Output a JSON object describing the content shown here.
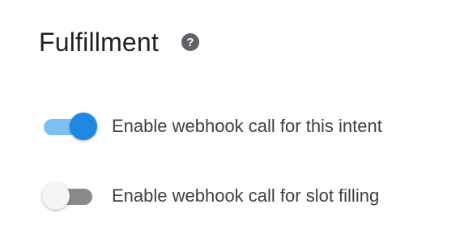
{
  "fulfillment": {
    "title": "Fulfillment",
    "help_icon": "help-circle-icon",
    "toggles": [
      {
        "label": "Enable webhook call for this intent",
        "enabled": true
      },
      {
        "label": "Enable webhook call for slot filling",
        "enabled": false
      }
    ]
  },
  "colors": {
    "accent": "#1e88e5",
    "accent_track": "#7cc0f2",
    "off_track": "#8a8a8a",
    "text": "#3c4043"
  }
}
